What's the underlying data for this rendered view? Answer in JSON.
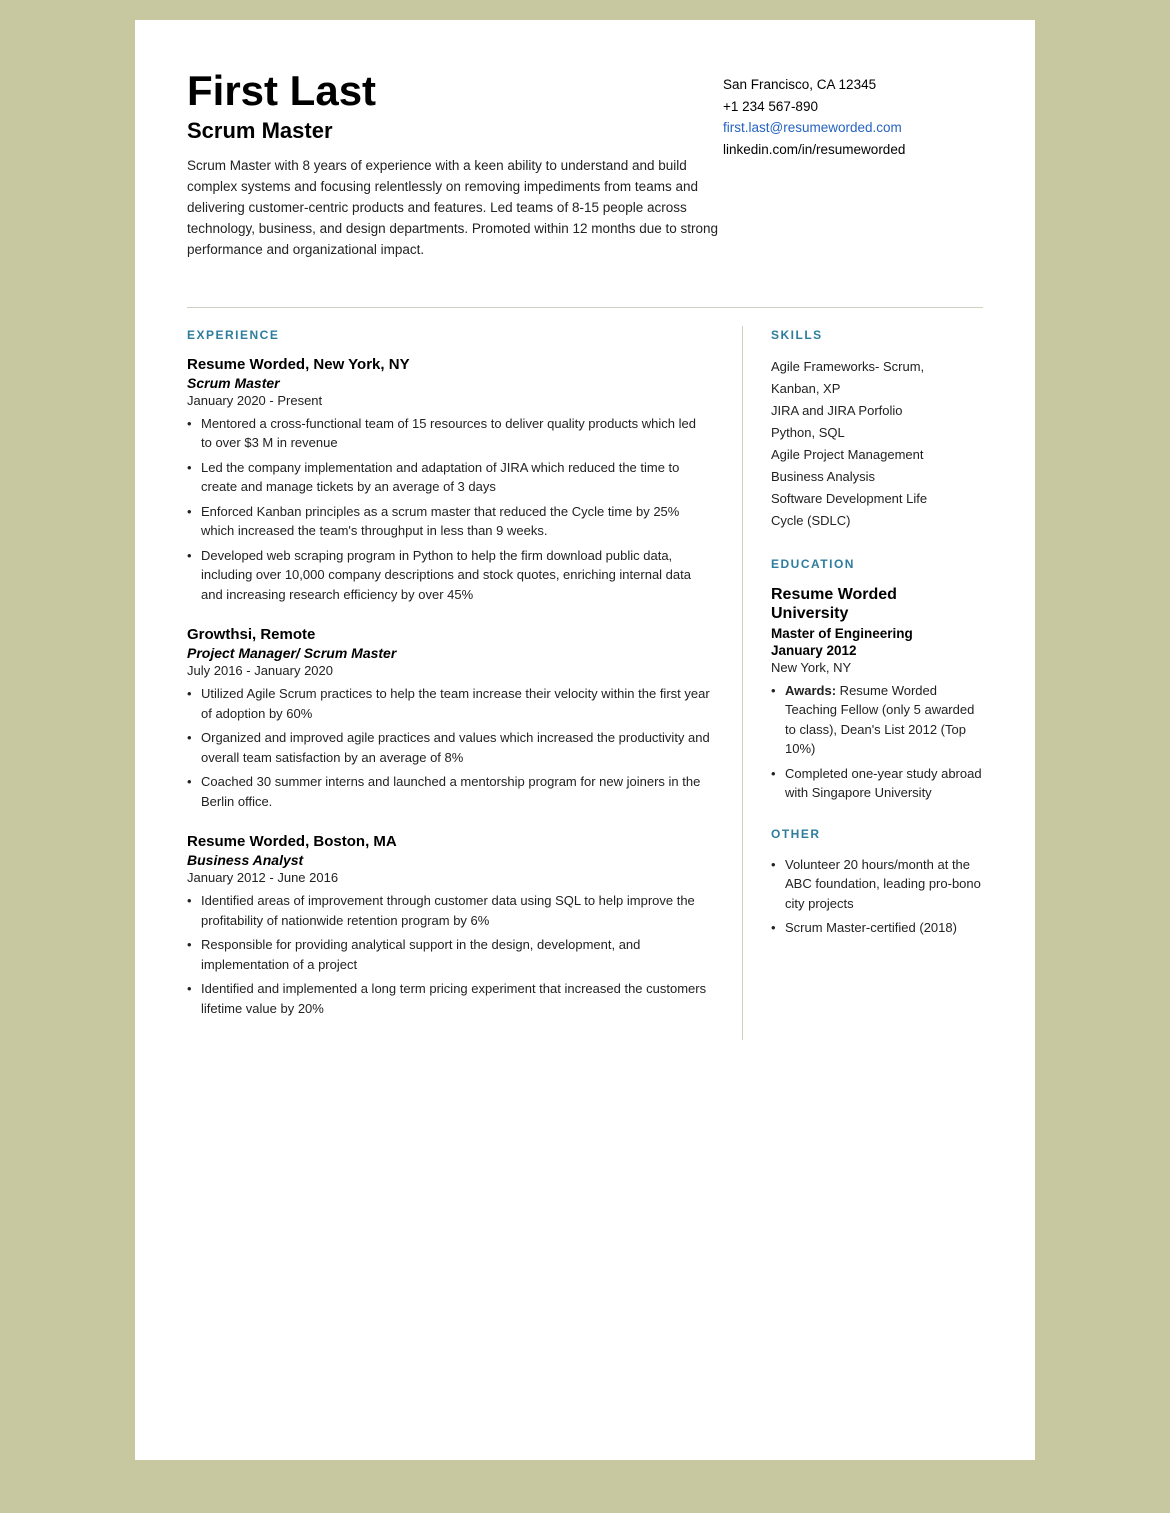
{
  "header": {
    "name": "First Last",
    "title": "Scrum Master",
    "summary": "Scrum Master with 8 years of experience with a keen ability to understand and build complex systems and focusing relentlessly on removing impediments from teams and delivering customer-centric products and features. Led teams of 8-15 people across technology, business, and design departments. Promoted within 12 months due to strong performance and organizational impact.",
    "contact": {
      "address": "San Francisco, CA 12345",
      "phone": "+1 234 567-890",
      "email": "first.last@resumeworded.com",
      "linkedin": "linkedin.com/in/resumeworded"
    }
  },
  "sections": {
    "experience_label": "EXPERIENCE",
    "skills_label": "SKILLS",
    "education_label": "EDUCATION",
    "other_label": "OTHER"
  },
  "experience": [
    {
      "company": "Resume Worded",
      "location": "New York, NY",
      "job_title": "Scrum Master",
      "dates": "January 2020 - Present",
      "bullets": [
        "Mentored a cross-functional team of 15 resources to deliver quality products which led to over $3 M in revenue",
        "Led the company implementation and adaptation of JIRA which reduced the time to create and manage tickets by an average of 3 days",
        "Enforced Kanban principles as a scrum master that reduced the Cycle time by 25% which increased the team's throughput in less than 9 weeks.",
        "Developed web scraping program in Python to help the firm download public data, including over 10,000 company descriptions and stock quotes, enriching internal data and increasing research efficiency by over 45%"
      ]
    },
    {
      "company": "Growthsi",
      "location": "Remote",
      "job_title": "Project Manager/ Scrum Master",
      "dates": "July 2016 - January 2020",
      "bullets": [
        "Utilized Agile Scrum practices to help the team increase their velocity within the first year of adoption by 60%",
        "Organized and improved agile practices and values which increased the productivity and overall team satisfaction by an average of 8%",
        "Coached 30 summer interns and launched a mentorship program for new joiners in the Berlin office."
      ]
    },
    {
      "company": "Resume Worded",
      "location": "Boston, MA",
      "job_title": "Business Analyst",
      "dates": "January 2012 - June 2016",
      "bullets": [
        "Identified areas of improvement through customer data using SQL to help improve the profitability of nationwide retention program by 6%",
        "Responsible for providing analytical support in the design, development, and implementation of a project",
        "Identified and implemented a long term pricing experiment that increased the customers lifetime value by 20%"
      ]
    }
  ],
  "skills": [
    "Agile Frameworks- Scrum, Kanban, XP",
    "JIRA and JIRA Porfolio",
    "Python, SQL",
    "Agile Project Management",
    "Business Analysis",
    "Software Development Life Cycle (SDLC)"
  ],
  "education": {
    "school": "Resume Worded University",
    "degree": "Master of Engineering",
    "date": "January 2012",
    "location": "New York, NY",
    "bullets": [
      "Awards: Resume Worded Teaching Fellow (only 5 awarded to class), Dean's List 2012 (Top 10%)",
      "Completed one-year study abroad with Singapore University"
    ]
  },
  "other": [
    "Volunteer 20 hours/month at the ABC foundation, leading pro-bono city projects",
    "Scrum Master-certified (2018)"
  ]
}
